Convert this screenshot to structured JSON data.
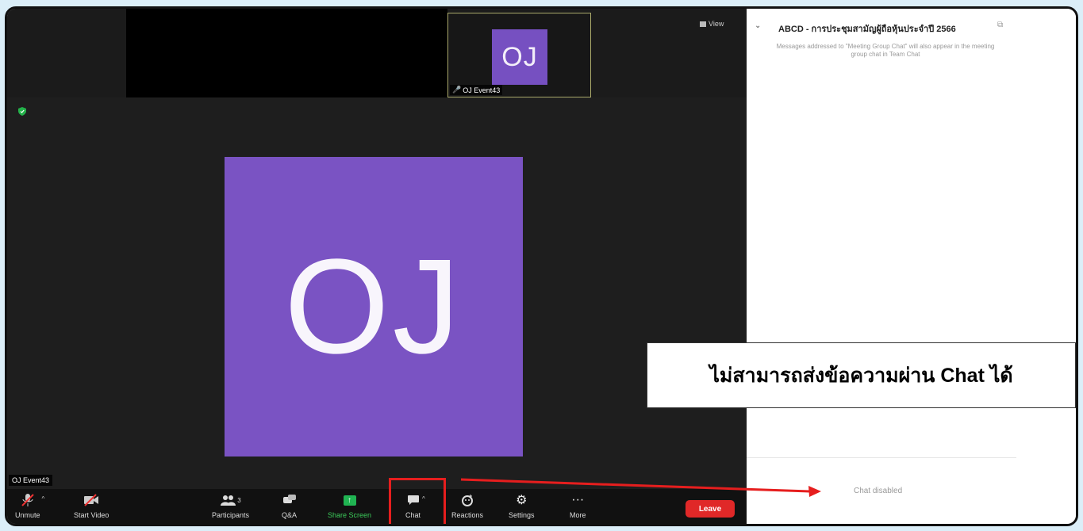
{
  "meeting": {
    "thumbnail": {
      "initials": "OJ",
      "name": "OJ Event43"
    },
    "view_label": "View",
    "main_avatar_initials": "OJ",
    "speaker_name": "OJ Event43"
  },
  "toolbar": {
    "unmute": "Unmute",
    "start_video": "Start Video",
    "participants": "Participants",
    "participants_count": "3",
    "qa": "Q&A",
    "share_screen": "Share Screen",
    "chat": "Chat",
    "reactions": "Reactions",
    "settings": "Settings",
    "more": "More",
    "leave": "Leave"
  },
  "chat_panel": {
    "title": "ABCD - การประชุมสามัญผู้ถือหุ้นประจำปี 2566",
    "note": "Messages addressed to \"Meeting Group Chat\" will also appear in the meeting group chat in Team Chat",
    "status": "Chat disabled"
  },
  "annotation": {
    "callout_text": "ไม่สามารถส่งข้อความผ่าน Chat ได้",
    "highlight_color": "#e61e1e"
  },
  "colors": {
    "avatar_purple": "#7a53c3",
    "leave_red": "#e02828",
    "share_green": "#20b452"
  }
}
